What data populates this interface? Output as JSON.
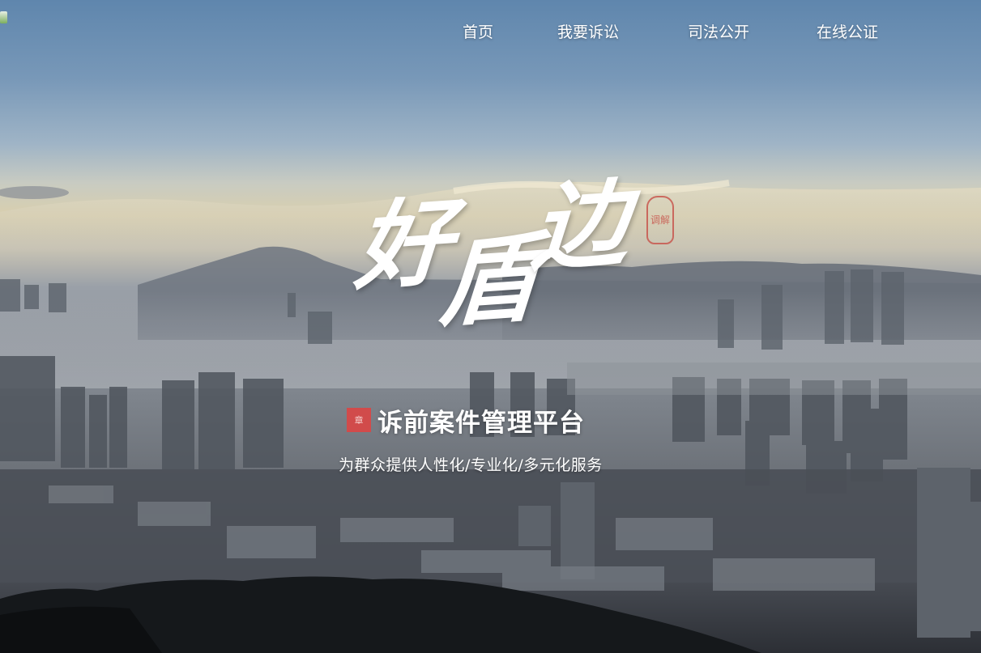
{
  "nav": {
    "items": [
      {
        "label": "首页"
      },
      {
        "label": "我要诉讼"
      },
      {
        "label": "司法公开"
      },
      {
        "label": "在线公证"
      }
    ]
  },
  "brand": {
    "calligraphy": [
      "好",
      "盾",
      "边"
    ],
    "seal_text": "调解"
  },
  "platform": {
    "title": "诉前案件管理平台",
    "seal_glyph": "章"
  },
  "tagline": "为群众提供人性化/专业化/多元化服务",
  "colors": {
    "nav_text": "#ffffff",
    "seal_red": "#d14b4b",
    "sky_top": "#5f86ad",
    "horizon_glow": "#d9cfae"
  },
  "icons": {
    "favicon": "site-favicon-icon"
  }
}
